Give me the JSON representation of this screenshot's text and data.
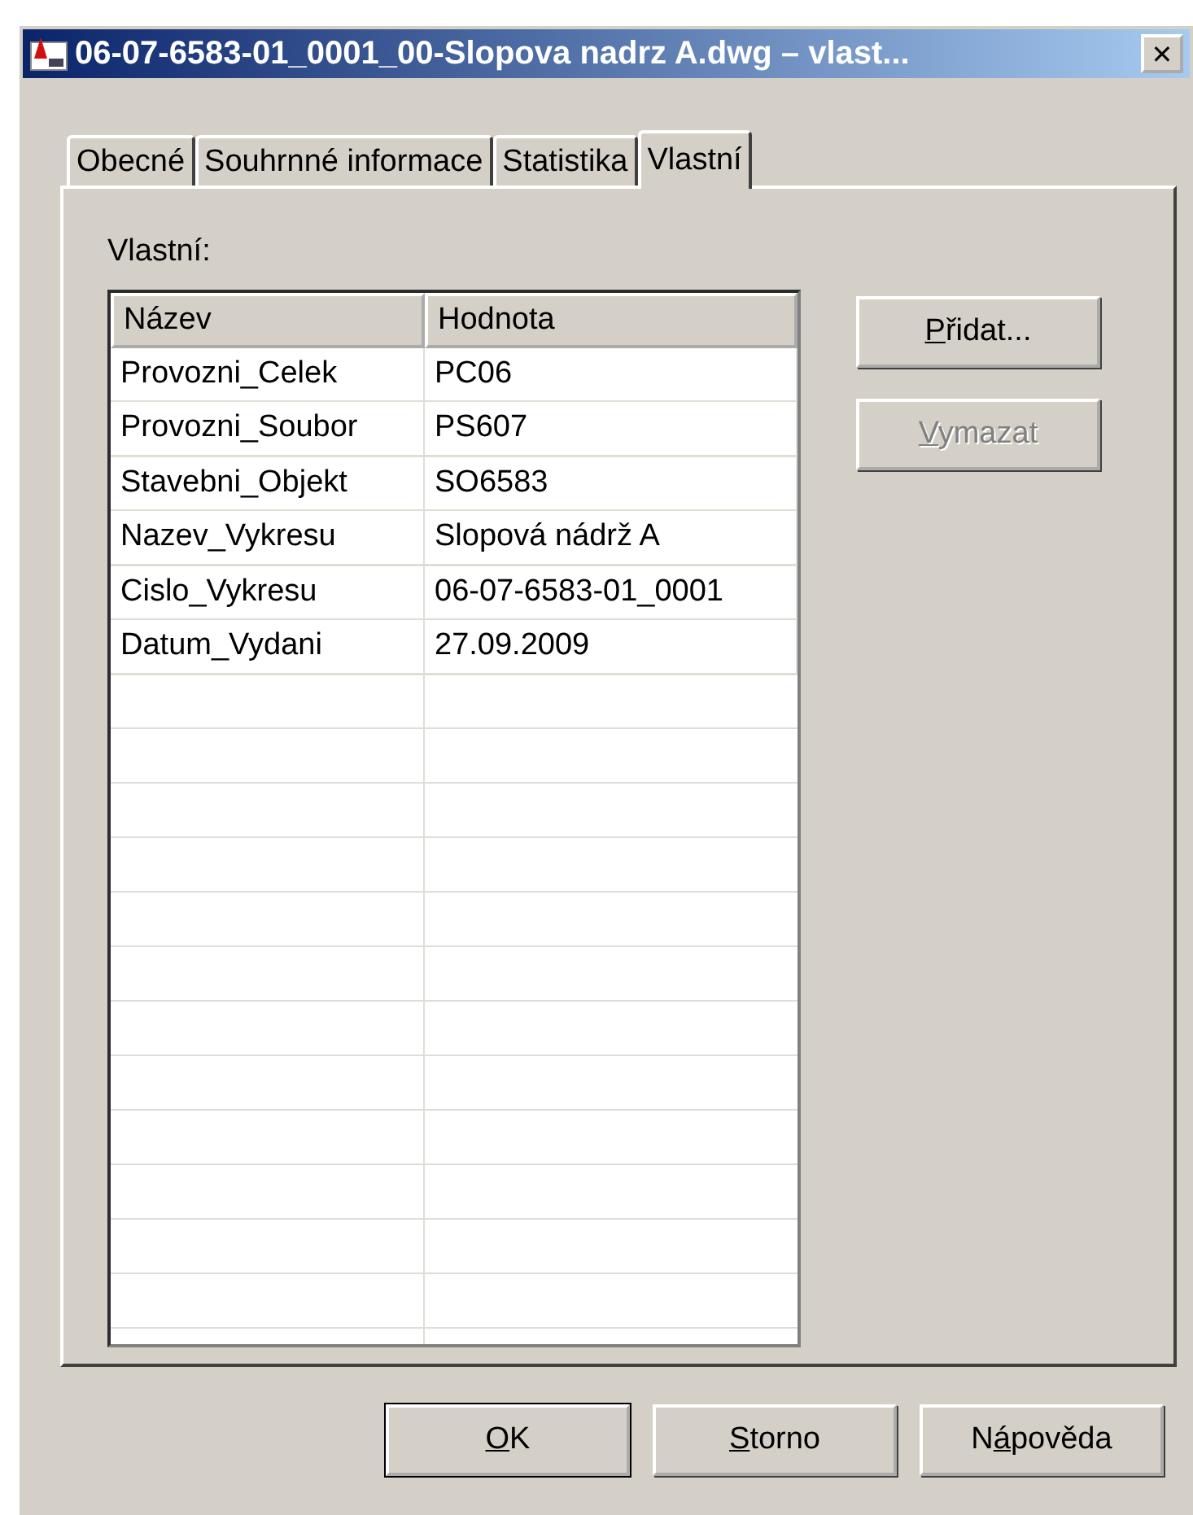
{
  "window": {
    "title": "06-07-6583-01_0001_00-Slopova nadrz A.dwg – vlast...",
    "close": "✕"
  },
  "tabs": [
    {
      "label": "Obecné",
      "selected": false
    },
    {
      "label": "Souhrnné informace",
      "selected": false
    },
    {
      "label": "Statistika",
      "selected": false
    },
    {
      "label": "Vlastní",
      "selected": true
    }
  ],
  "panel": {
    "label": "Vlastní:",
    "table": {
      "columns": [
        "Název",
        "Hodnota"
      ],
      "rows": [
        [
          "Provozni_Celek",
          "PC06"
        ],
        [
          "Provozni_Soubor",
          "PS607"
        ],
        [
          "Stavebni_Objekt",
          "SO6583"
        ],
        [
          "Nazev_Vykresu",
          "Slopová nádrž A"
        ],
        [
          "Cislo_Vykresu",
          "06-07-6583-01_0001"
        ],
        [
          "Datum_Vydani",
          "27.09.2009"
        ]
      ]
    },
    "buttons": [
      {
        "access_key": "P",
        "rest": "řidat...",
        "disabled": false
      },
      {
        "access_key": "V",
        "rest": "ymazat",
        "disabled": true
      }
    ]
  },
  "buttons": [
    {
      "access_key": "O",
      "rest": "K",
      "default": true
    },
    {
      "access_key": "S",
      "rest": "torno",
      "default": false
    },
    {
      "lead": "N",
      "access_key": "á",
      "rest": "pověda",
      "default": false
    }
  ]
}
